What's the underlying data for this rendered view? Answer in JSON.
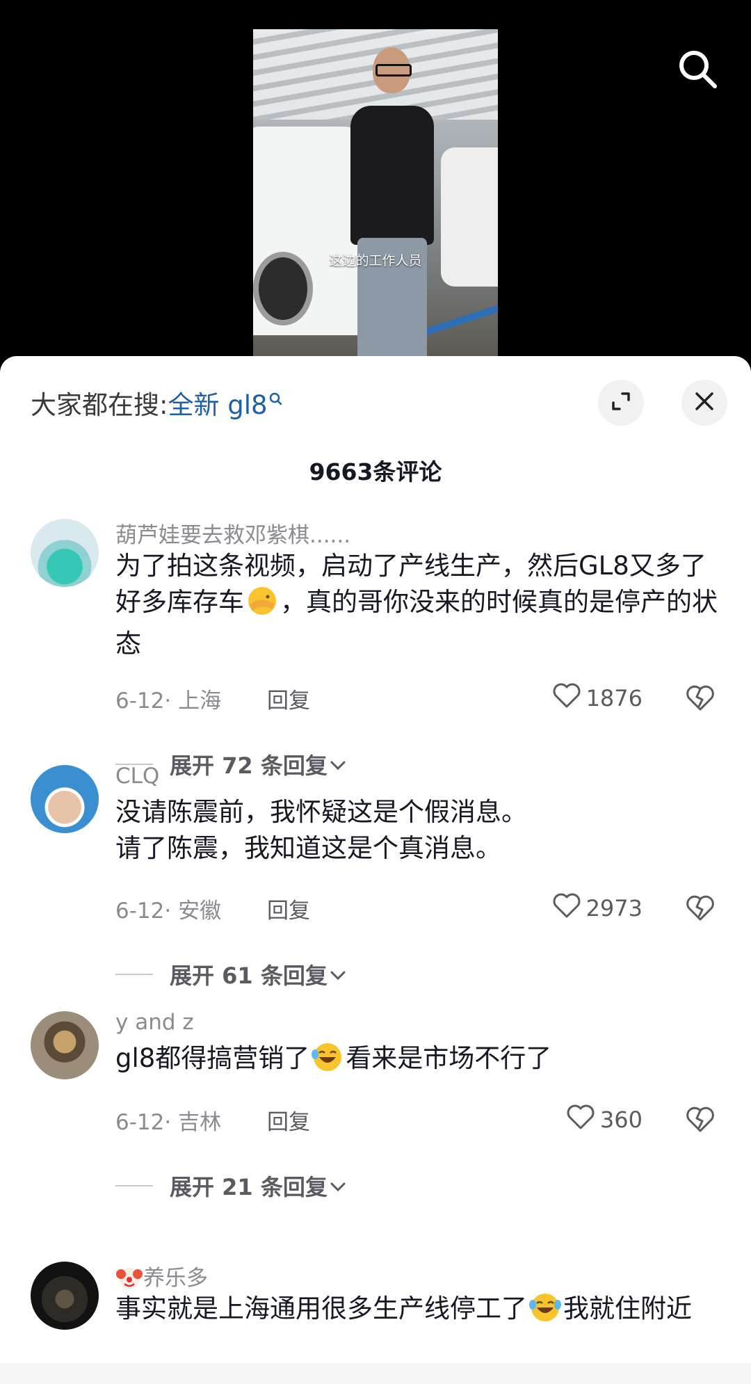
{
  "video": {
    "subtitle": "这边的工作人员"
  },
  "header": {
    "hot_search_prefix": "大家都在搜:",
    "hot_search_keyword": "全新 gl8",
    "comment_count": "9663条评论"
  },
  "comments": [
    {
      "username": "葫芦娃要去救邓紫棋......",
      "text_a": "为了拍这条视频，启动了产线生产，然后GL8又多了好多库存车",
      "text_b": "，真的哥你没来的时候真的是停产的状态",
      "meta": "6-12· 上海",
      "reply": "回复",
      "likes": "1876",
      "expand": "展开 72 条回复"
    },
    {
      "username": "CLQ",
      "line1": "没请陈震前，我怀疑这是个假消息。",
      "line2": "请了陈震，我知道这是个真消息。",
      "meta": "6-12· 安徽",
      "reply": "回复",
      "likes": "2973",
      "expand": "展开 61 条回复"
    },
    {
      "username": "y and z",
      "text_a": "gl8都得搞营销了",
      "text_b": "看来是市场不行了",
      "meta": "6-12· 吉林",
      "reply": "回复",
      "likes": "360",
      "expand": "展开 21 条回复"
    },
    {
      "username": "养乐多",
      "text_a": "事实就是上海通用很多生产线停工了",
      "text_b": "我就住附近"
    }
  ],
  "icons": {
    "search": "search-icon",
    "expand": "expand-icon",
    "close": "close-icon",
    "like": "heart-icon",
    "dislike": "broken-heart-icon",
    "chevron": "chevron-down-icon"
  },
  "colors": {
    "keyword": "#1f5fa8",
    "secondary_text": "#8a8b91"
  }
}
